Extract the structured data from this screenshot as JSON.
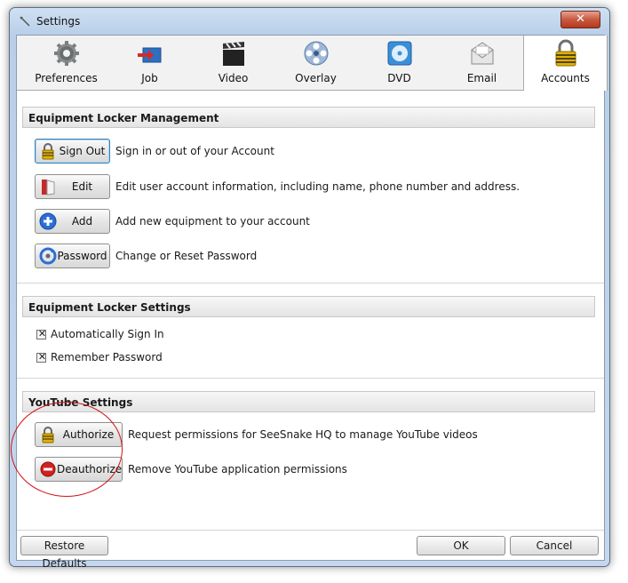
{
  "window": {
    "title": "Settings",
    "close_glyph": "✕"
  },
  "tabs": [
    {
      "label": "Preferences",
      "icon": "gear-icon"
    },
    {
      "label": "Job",
      "icon": "job-arrow-icon"
    },
    {
      "label": "Video",
      "icon": "clapperboard-icon"
    },
    {
      "label": "Overlay",
      "icon": "film-reel-icon"
    },
    {
      "label": "DVD",
      "icon": "dvd-icon"
    },
    {
      "label": "Email",
      "icon": "envelope-icon"
    },
    {
      "label": "Accounts",
      "icon": "padlock-icon",
      "active": true
    }
  ],
  "locker_management": {
    "header": "Equipment Locker Management",
    "rows": [
      {
        "button": "Sign Out",
        "icon": "lock-icon",
        "description": "Sign in or out of your Account"
      },
      {
        "button": "Edit",
        "icon": "book-icon",
        "description": "Edit user account information, including name, phone number and address."
      },
      {
        "button": "Add",
        "icon": "plus-circle-icon",
        "description": "Add new equipment to your account"
      },
      {
        "button": "Password",
        "icon": "refresh-key-icon",
        "description": "Change or Reset Password"
      }
    ]
  },
  "locker_settings": {
    "header": "Equipment Locker Settings",
    "options": [
      {
        "label": "Automatically Sign In",
        "checked": true
      },
      {
        "label": "Remember Password",
        "checked": true
      }
    ]
  },
  "youtube": {
    "header": "YouTube Settings",
    "rows": [
      {
        "button": "Authorize",
        "icon": "lock-icon",
        "description": "Request permissions for SeeSnake HQ to manage YouTube videos"
      },
      {
        "button": "Deauthorize",
        "icon": "no-entry-icon",
        "description": "Remove YouTube application permissions"
      }
    ]
  },
  "footer": {
    "restore": "Restore Defaults",
    "ok": "OK",
    "cancel": "Cancel"
  }
}
